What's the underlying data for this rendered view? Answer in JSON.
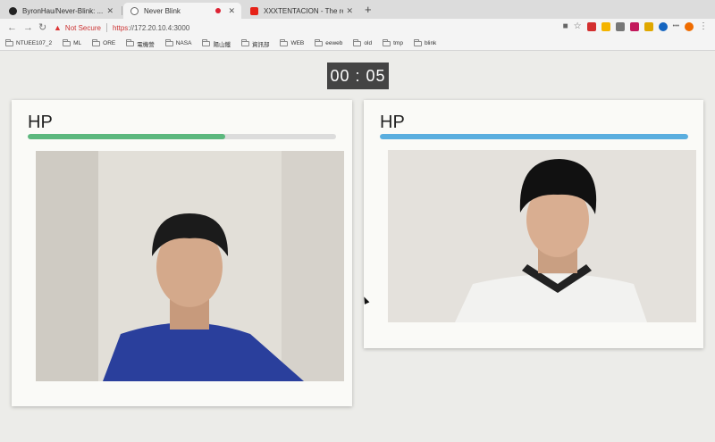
{
  "browser": {
    "tabs": [
      {
        "label": "ByronHau/Never-Blink: ...",
        "favicon_color": "#222222",
        "active": false
      },
      {
        "label": "Never Blink",
        "favicon_color": "#666666",
        "active": true,
        "recording": true
      },
      {
        "label": "XXXTENTACION - The remedy",
        "favicon_color": "#e62117",
        "active": false
      }
    ],
    "new_tab_label": "+",
    "address": {
      "warning": "Not Secure",
      "scheme": "https",
      "rest": "://172.20.10.4:3000"
    },
    "bookmarks": [
      "NTUEE107_2",
      "ML",
      "ORE",
      "電機營",
      "NASA",
      "陽山鐵",
      "資訊部",
      "WEB",
      "eeweb",
      "old",
      "tmp",
      "blink"
    ],
    "toolbar_icons": [
      {
        "name": "camera-icon",
        "color": "#666666"
      },
      {
        "name": "star-icon",
        "color": "#666666"
      },
      {
        "name": "extension-red-icon",
        "color": "#d32f2f"
      },
      {
        "name": "extension-drive-icon",
        "color": "#f4b400"
      },
      {
        "name": "extension-gray-icon",
        "color": "#777777"
      },
      {
        "name": "extension-pink-icon",
        "color": "#c2185b"
      },
      {
        "name": "extension-yellow-icon",
        "color": "#e0a800"
      },
      {
        "name": "extension-blue-icon",
        "color": "#1565c0"
      },
      {
        "name": "extension-ellipsis-icon",
        "color": "#888888"
      },
      {
        "name": "extension-orange-icon",
        "color": "#ef6c00"
      }
    ]
  },
  "timer": {
    "text": "00 : 05"
  },
  "players": [
    {
      "hp_label": "HP",
      "hp_fraction": 0.64,
      "bar_color": "#5cb87e"
    },
    {
      "hp_label": "HP",
      "hp_fraction": 1.0,
      "bar_color": "#5aaedf"
    }
  ]
}
